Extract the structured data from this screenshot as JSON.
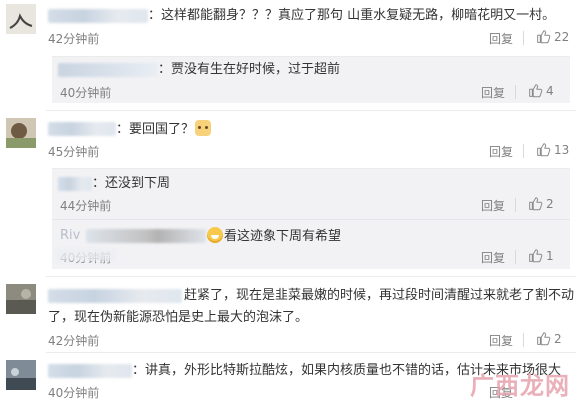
{
  "comments": [
    {
      "text": "：这样都能翻身？？？真应了那句 山重水复疑无路，柳暗花明又一村。",
      "time": "42分钟前",
      "reply": "回复",
      "likes": "22",
      "replies": [
        {
          "text": "：贾没有生在好时候，过于超前",
          "time": "40分钟前",
          "reply": "回复",
          "likes": "4"
        }
      ]
    },
    {
      "text": "：要回国了？",
      "time": "45分钟前",
      "reply": "回复",
      "likes": "13",
      "replies": [
        {
          "text": "：还没到下周",
          "time": "44分钟前",
          "reply": "回复",
          "likes": "2"
        },
        {
          "name": "Riv",
          "text": "看这迹象下周有希望",
          "time": "40分钟前",
          "reply": "回复",
          "likes": "1"
        }
      ]
    },
    {
      "text_line1": "赶紧了，现在是韭菜最嫩的时候，再过段时间清醒过来就老了割不动",
      "text_line2": "了，现在伪新能源恐怕是史上最大的泡沫了。",
      "time": "42分钟前",
      "reply": "回复",
      "likes": "2"
    },
    {
      "text": "：讲真，外形比特斯拉酷炫，如果内核质量也不错的话，估计未来市场很大",
      "time": "40分钟前",
      "reply": "回复",
      "likes": ""
    }
  ],
  "icons": {
    "like": "thumbs-up-icon",
    "laugh": "laughing-emoji",
    "cat": "cat-face-emoji"
  },
  "watermark": "广西龙网",
  "colors": {
    "meta": "#808080",
    "text": "#333333",
    "sub_bg": "#f2f2f5"
  }
}
